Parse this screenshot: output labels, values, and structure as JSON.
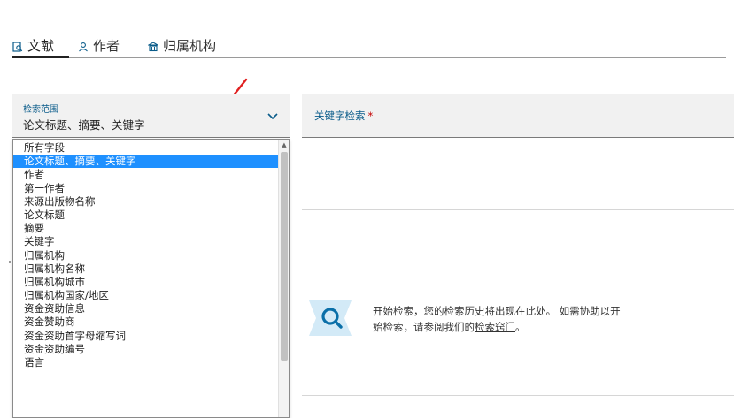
{
  "tabs": [
    {
      "label": "文献",
      "icon": "document-search-icon",
      "active": true
    },
    {
      "label": "作者",
      "icon": "person-icon",
      "active": false
    },
    {
      "label": "归属机构",
      "icon": "institution-icon",
      "active": false
    }
  ],
  "scope": {
    "label": "检索范围",
    "value": "论文标题、摘要、关键字"
  },
  "keyword": {
    "label": "关键字检索",
    "required_mark": "*"
  },
  "dropdown": {
    "selected_index": 1,
    "items": [
      "所有字段",
      "论文标题、摘要、关键字",
      "作者",
      "第一作者",
      "来源出版物名称",
      "论文标题",
      "摘要",
      "关键字",
      "归属机构",
      "归属机构名称",
      "归属机构城市",
      "归属机构国家/地区",
      "资金资助信息",
      "资金赞助商",
      "资金资助首字母缩写词",
      "资金资助编号",
      "语言"
    ]
  },
  "empty_state": {
    "line1": "开始检索，您的检索历史将出现在此处。 如需协助以开",
    "line2_prefix": "始检索，请参阅我们的",
    "line2_link": "检索窍门",
    "line2_suffix": "。"
  },
  "colors": {
    "accent_blue": "#0a5c8a",
    "selected_bg": "#1e90ff",
    "required_red": "#c40000",
    "arrow_red": "#e02020",
    "field_bg": "#f1f1f1"
  }
}
